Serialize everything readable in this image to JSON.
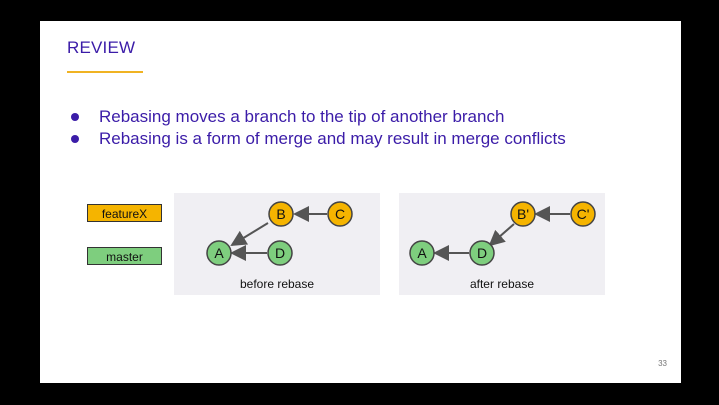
{
  "slide": {
    "title": "REVIEW",
    "bullets": [
      "Rebasing moves a branch to the tip of another branch",
      "Rebasing is a form of merge and may result in merge conflicts"
    ],
    "page_number": "33"
  },
  "legend": {
    "feature": "featureX",
    "master": "master"
  },
  "before": {
    "caption": "before rebase",
    "nodes": {
      "A": "A",
      "B": "B",
      "C": "C",
      "D": "D"
    }
  },
  "after": {
    "caption": "after rebase",
    "nodes": {
      "A": "A",
      "D": "D",
      "B": "B'",
      "C": "C'"
    }
  },
  "colors": {
    "title": "#3b1ca8",
    "accent_rule": "#f0b323",
    "feature": "#f5b400",
    "master": "#7ece7e",
    "panel": "#f0eff3",
    "arrow": "#555555"
  }
}
